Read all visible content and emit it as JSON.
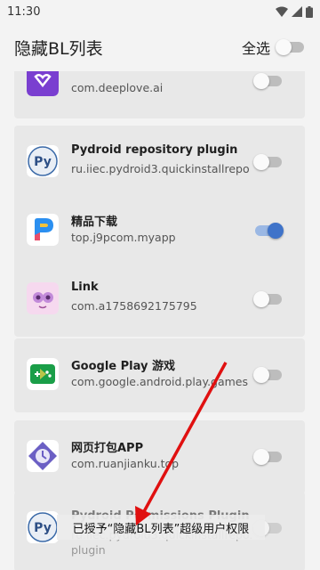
{
  "status_bar": {
    "time": "11:30",
    "icons": [
      "wifi-icon",
      "signal-icon",
      "battery-icon"
    ]
  },
  "header": {
    "title": "隐藏BL列表",
    "select_all_label": "全选",
    "select_all_on": false
  },
  "apps": [
    {
      "name": "",
      "package": "com.deeplove.ai",
      "enabled": false,
      "icon": "deeplove-icon"
    },
    {
      "name": "Pydroid repository plugin",
      "package": "ru.iiec.pydroid3.quickinstallrepo",
      "enabled": false,
      "icon": "pydroid-icon"
    },
    {
      "name": "精品下载",
      "package": "top.j9pcom.myapp",
      "enabled": true,
      "icon": "jingpin-download-icon"
    },
    {
      "name": "Link",
      "package": "com.a1758692175795",
      "enabled": false,
      "icon": "link-app-icon"
    },
    {
      "name": "Google Play 游戏",
      "package": "com.google.android.play.games",
      "enabled": false,
      "icon": "google-play-games-icon"
    },
    {
      "name": "网页打包APP",
      "package": "com.ruanjianku.top",
      "enabled": false,
      "icon": "web-pack-icon"
    },
    {
      "name": "Pydroid Permissions Plugin",
      "package": "ru.iiec.pydroid3.quickinstallrepo.plugin",
      "enabled": false,
      "icon": "pydroid-permissions-icon"
    }
  ],
  "toast": {
    "message": "已授予“隐藏BL列表”超级用户权限"
  },
  "colors": {
    "accent": "#3f73c9",
    "annotation_arrow": "#e01010"
  }
}
